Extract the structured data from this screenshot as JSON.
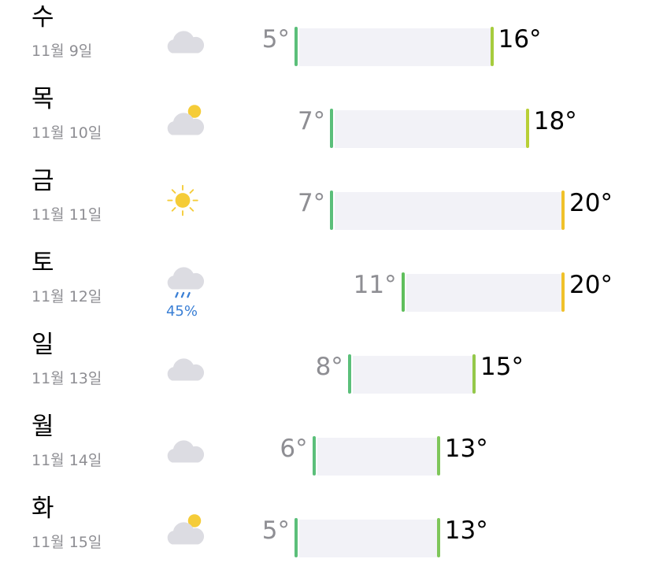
{
  "forecast": {
    "days": [
      {
        "day": "수",
        "date": "11월 9일",
        "icon": "cloud-icon",
        "low": "5°",
        "high": "16°",
        "precip": null,
        "low_color": "#5bbf7a",
        "high_color": "#a6cc3d"
      },
      {
        "day": "목",
        "date": "11월 10일",
        "icon": "partly-cloudy-icon",
        "low": "7°",
        "high": "18°",
        "precip": null,
        "low_color": "#5bbf7a",
        "high_color": "#b8cf36"
      },
      {
        "day": "금",
        "date": "11월 11일",
        "icon": "sun-icon",
        "low": "7°",
        "high": "20°",
        "precip": null,
        "low_color": "#5bbf7a",
        "high_color": "#f0c12a"
      },
      {
        "day": "토",
        "date": "11월 12일",
        "icon": "rain-icon",
        "low": "11°",
        "high": "20°",
        "precip": "45%",
        "low_color": "#5fbf5c",
        "high_color": "#f0c12a"
      },
      {
        "day": "일",
        "date": "11월 13일",
        "icon": "cloud-icon",
        "low": "8°",
        "high": "15°",
        "precip": null,
        "low_color": "#5bbf7a",
        "high_color": "#94c84a"
      },
      {
        "day": "월",
        "date": "11월 14일",
        "icon": "cloud-icon",
        "low": "6°",
        "high": "13°",
        "precip": null,
        "low_color": "#5bbf7a",
        "high_color": "#7fc65a"
      },
      {
        "day": "화",
        "date": "11월 15일",
        "icon": "partly-cloudy-icon",
        "low": "5°",
        "high": "13°",
        "precip": null,
        "low_color": "#5bbf7a",
        "high_color": "#7fc65a"
      }
    ],
    "range_min": 5,
    "range_max": 20
  },
  "colors": {
    "cloud": "#dcdce2",
    "sun": "#f5cc38",
    "rain": "#3a7fd5",
    "bar_track": "#f2f2f7"
  }
}
